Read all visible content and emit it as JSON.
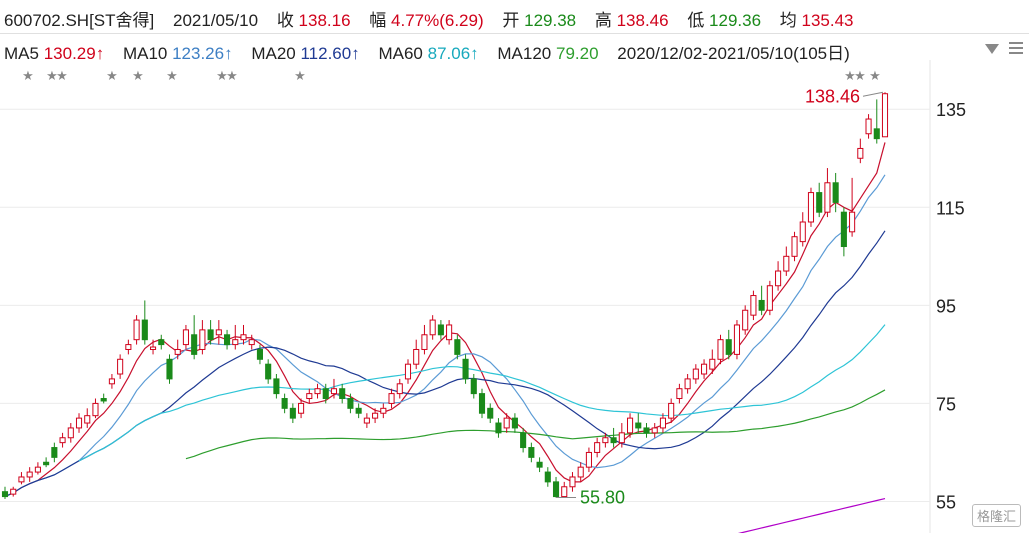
{
  "header": {
    "code": "600702.SH[ST舍得]",
    "date": "2021/05/10",
    "close_label": "收",
    "close": "138.16",
    "chg_label": "幅",
    "chg": "4.77%(6.29)",
    "open_label": "开",
    "open": "129.38",
    "high_label": "高",
    "high": "138.46",
    "low_label": "低",
    "low": "129.36",
    "avg_label": "均",
    "avg": "135.43"
  },
  "ma": {
    "ma5_label": "MA5",
    "ma5": "130.29↑",
    "ma10_label": "MA10",
    "ma10": "123.26↑",
    "ma20_label": "MA20",
    "ma20": "112.60↑",
    "ma60_label": "MA60",
    "ma60": "87.06↑",
    "ma120_label": "MA120",
    "ma120": "79.20",
    "range_text": "2020/12/02-2021/05/10(105日)"
  },
  "colors": {
    "up": "#d0021b",
    "down": "#1a8a1a",
    "ma5": "#c8102e",
    "ma10": "#5b9bd5",
    "ma20": "#1f3a93",
    "ma60": "#2ec4d6",
    "ma120": "#2e9e2e",
    "ma250": "#b000c8"
  },
  "watermark": "格隆汇",
  "chart_data": {
    "type": "candlestick",
    "y_ticks": [
      55,
      75,
      95,
      115,
      135
    ],
    "ylim": [
      50,
      143
    ],
    "max_label": "138.46",
    "min_label": "55.80",
    "candles": [
      [
        57,
        56,
        58,
        55.5
      ],
      [
        56.5,
        57.5,
        58,
        56
      ],
      [
        59,
        60,
        61,
        58.5
      ],
      [
        60,
        61,
        62,
        59
      ],
      [
        61,
        62,
        63,
        60.5
      ],
      [
        63,
        62.5,
        64,
        62
      ],
      [
        66,
        64,
        67,
        63
      ],
      [
        67,
        68,
        69,
        66
      ],
      [
        68,
        70,
        71,
        67
      ],
      [
        70,
        72,
        73,
        69
      ],
      [
        71,
        72.5,
        74,
        70
      ],
      [
        72.5,
        75,
        76,
        72
      ],
      [
        76,
        75.5,
        77,
        75
      ],
      [
        79,
        80,
        81,
        78
      ],
      [
        81,
        84,
        85,
        80
      ],
      [
        86,
        87,
        88,
        85
      ],
      [
        88,
        92,
        93,
        87
      ],
      [
        92,
        88,
        96,
        87
      ],
      [
        86,
        86.5,
        88,
        85
      ],
      [
        88,
        87,
        89,
        86
      ],
      [
        84,
        80,
        85,
        79
      ],
      [
        85,
        86,
        88,
        84
      ],
      [
        87,
        90,
        91,
        86
      ],
      [
        89,
        85,
        93,
        84
      ],
      [
        86,
        90,
        92,
        85
      ],
      [
        90,
        88,
        92,
        87
      ],
      [
        89,
        90,
        92,
        87
      ],
      [
        89,
        87,
        90,
        86
      ],
      [
        87,
        88,
        91,
        86
      ],
      [
        88,
        89,
        91,
        87
      ],
      [
        87,
        88,
        89,
        86
      ],
      [
        86,
        84,
        87,
        83
      ],
      [
        83,
        80,
        84,
        79
      ],
      [
        80,
        77,
        81,
        76
      ],
      [
        76,
        74,
        77,
        73
      ],
      [
        74,
        72,
        75,
        71
      ],
      [
        73,
        75,
        76,
        72
      ],
      [
        76,
        77,
        78,
        75
      ],
      [
        77,
        78,
        79,
        76
      ],
      [
        78,
        76,
        79,
        75
      ],
      [
        77,
        78,
        80,
        76
      ],
      [
        78,
        76,
        79,
        75
      ],
      [
        76,
        74,
        77,
        73
      ],
      [
        74,
        73,
        75,
        72
      ],
      [
        71,
        72,
        73,
        70
      ],
      [
        72,
        73,
        74,
        71
      ],
      [
        73,
        74,
        75,
        72
      ],
      [
        75,
        77,
        78,
        74
      ],
      [
        77,
        79,
        80,
        76
      ],
      [
        80,
        83,
        84,
        79
      ],
      [
        83,
        86,
        88,
        82
      ],
      [
        86,
        89,
        91,
        85
      ],
      [
        89,
        92,
        93,
        88
      ],
      [
        91,
        89,
        92,
        88
      ],
      [
        88,
        91,
        92,
        87
      ],
      [
        88,
        85,
        89,
        84
      ],
      [
        84,
        80,
        85,
        79
      ],
      [
        80,
        77,
        81,
        76
      ],
      [
        77,
        73,
        78,
        72
      ],
      [
        74,
        72,
        75,
        71
      ],
      [
        71,
        69,
        72,
        68
      ],
      [
        70,
        72,
        73,
        69
      ],
      [
        72,
        70,
        73,
        69
      ],
      [
        69,
        66,
        70,
        65
      ],
      [
        66,
        64,
        67,
        63
      ],
      [
        63,
        62,
        64,
        61
      ],
      [
        61,
        59,
        62,
        58
      ],
      [
        59,
        56,
        60,
        55.8
      ],
      [
        56,
        58,
        59,
        55.8
      ],
      [
        58,
        60,
        61,
        57
      ],
      [
        60,
        62,
        63,
        59
      ],
      [
        62,
        65,
        66,
        61
      ],
      [
        65,
        67,
        68,
        64
      ],
      [
        67,
        68,
        69,
        66
      ],
      [
        68,
        67,
        70,
        66
      ],
      [
        67,
        69,
        71,
        66
      ],
      [
        69,
        72,
        73,
        68
      ],
      [
        71,
        70,
        73,
        69
      ],
      [
        70,
        69,
        71,
        68
      ],
      [
        69,
        70,
        71,
        68
      ],
      [
        70,
        72,
        73,
        69
      ],
      [
        72,
        75,
        76,
        71
      ],
      [
        76,
        78,
        79,
        75
      ],
      [
        78,
        80,
        81,
        77
      ],
      [
        80,
        82,
        83,
        79
      ],
      [
        81,
        83,
        84,
        80
      ],
      [
        82,
        84,
        86,
        81
      ],
      [
        84,
        88,
        89,
        83
      ],
      [
        88,
        85,
        90,
        84
      ],
      [
        85,
        91,
        92,
        84
      ],
      [
        90,
        94,
        95,
        89
      ],
      [
        93,
        97,
        98,
        92
      ],
      [
        96,
        94,
        99,
        93
      ],
      [
        94,
        99,
        100,
        93
      ],
      [
        99,
        102,
        104,
        98
      ],
      [
        102,
        105,
        107,
        101
      ],
      [
        105,
        109,
        110,
        104
      ],
      [
        108,
        112,
        114,
        107
      ],
      [
        112,
        118,
        119,
        111
      ],
      [
        118,
        114,
        120,
        113
      ],
      [
        114,
        120,
        123,
        113
      ],
      [
        120,
        116,
        122,
        114
      ],
      [
        114,
        107,
        115,
        105
      ],
      [
        110,
        114,
        121,
        109
      ],
      [
        125,
        127,
        129,
        124
      ],
      [
        130,
        133,
        134,
        129
      ],
      [
        131,
        129,
        137,
        128
      ],
      [
        129.38,
        138.16,
        138.46,
        129.36
      ]
    ]
  }
}
